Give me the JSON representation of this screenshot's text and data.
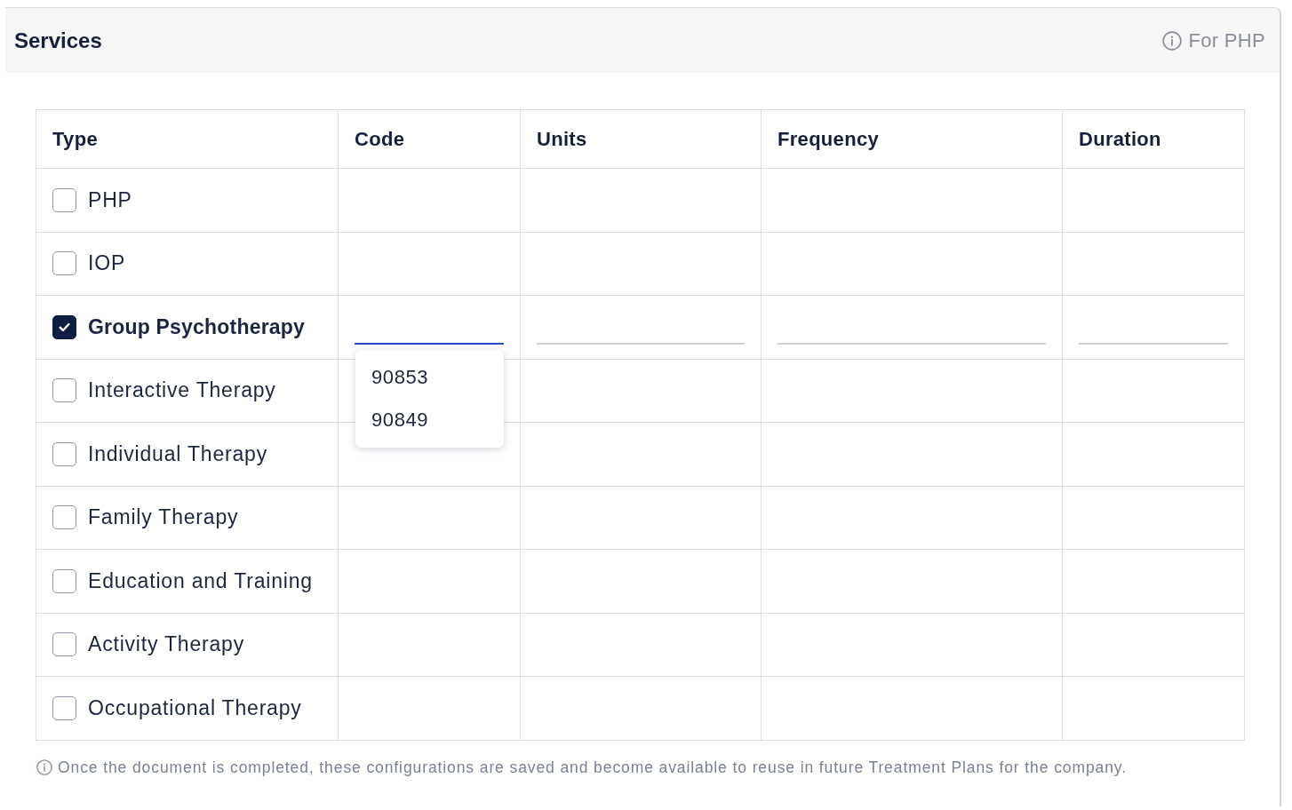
{
  "card": {
    "title": "Services",
    "note": "For PHP"
  },
  "table": {
    "columns": [
      "Type",
      "Code",
      "Units",
      "Frequency",
      "Duration"
    ],
    "rows": [
      {
        "type": "PHP",
        "checked": false
      },
      {
        "type": "IOP",
        "checked": false
      },
      {
        "type": "Group Psychotherapy",
        "checked": true,
        "fields": [
          {
            "focused": true,
            "options": [
              "90853",
              "90849"
            ]
          },
          {
            "focused": false
          },
          {
            "focused": false
          },
          {
            "focused": false
          }
        ]
      },
      {
        "type": "Interactive Therapy",
        "checked": false
      },
      {
        "type": "Individual Therapy",
        "checked": false
      },
      {
        "type": "Family Therapy",
        "checked": false
      },
      {
        "type": "Education and Training",
        "checked": false
      },
      {
        "type": "Activity Therapy",
        "checked": false
      },
      {
        "type": "Occupational Therapy",
        "checked": false
      }
    ]
  },
  "footnote": "Once the document is completed, these configurations are saved and become available to reuse in future Treatment Plans for the company."
}
